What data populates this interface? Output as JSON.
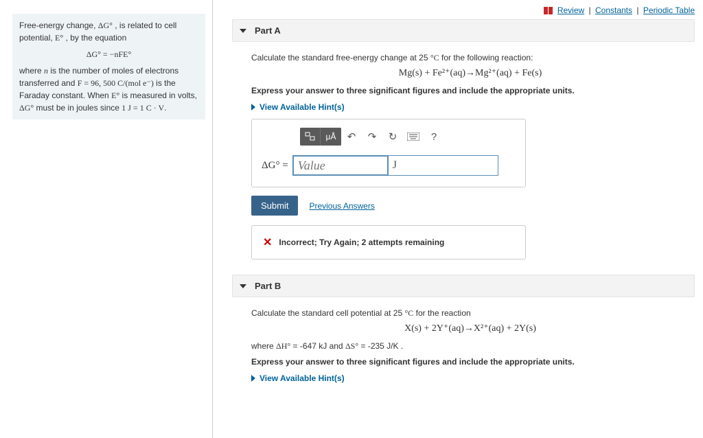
{
  "topLinks": {
    "review": "Review",
    "constants": "Constants",
    "periodic": "Periodic Table"
  },
  "leftInfo": {
    "l1a": "Free-energy change, ",
    "l1b": "ΔG°",
    "l1c": " , is related to cell potential, ",
    "l1d": "E°",
    "l1e": " , by the equation",
    "eq": "ΔG° = −nFE°",
    "l2a": "where ",
    "l2b": "n",
    "l2c": " is the number of moles of electrons transferred and ",
    "l2d": "F = 96, 500 C/(mol e⁻)",
    "l2e": " is the Faraday constant. When ",
    "l2f": "E°",
    "l2g": " is measured in volts, ",
    "l2h": "ΔG°",
    "l2i": " must be in joules since ",
    "l2j": "1 J = 1 C · V",
    "l2k": "."
  },
  "partA": {
    "title": "Part A",
    "q1a": "Calculate the standard free-energy change at 25 ",
    "q1b": "°C",
    "q1c": " for the following reaction:",
    "reaction": "Mg(s) + Fe²⁺(aq)→Mg²⁺(aq) + Fe(s)",
    "instruct": "Express your answer to three significant figures and include the appropriate units.",
    "hints": "View Available Hint(s)",
    "label": "ΔG° = ",
    "valuePlaceholder": "Value",
    "unitValue": "J",
    "tbUnits": "μÅ",
    "submit": "Submit",
    "prev": "Previous Answers",
    "feedback": "Incorrect; Try Again; 2 attempts remaining"
  },
  "partB": {
    "title": "Part B",
    "q1a": "Calculate the standard cell potential at 25 ",
    "q1b": "°C",
    "q1c": " for the reaction",
    "reaction": "X(s) + 2Y⁺(aq)→X²⁺(aq) + 2Y(s)",
    "where_a": "where ",
    "where_b": "ΔH°",
    "where_c": " = -647 kJ and ",
    "where_d": "ΔS°",
    "where_e": " = -235 J/K .",
    "instruct": "Express your answer to three significant figures and include the appropriate units.",
    "hints": "View Available Hint(s)"
  }
}
